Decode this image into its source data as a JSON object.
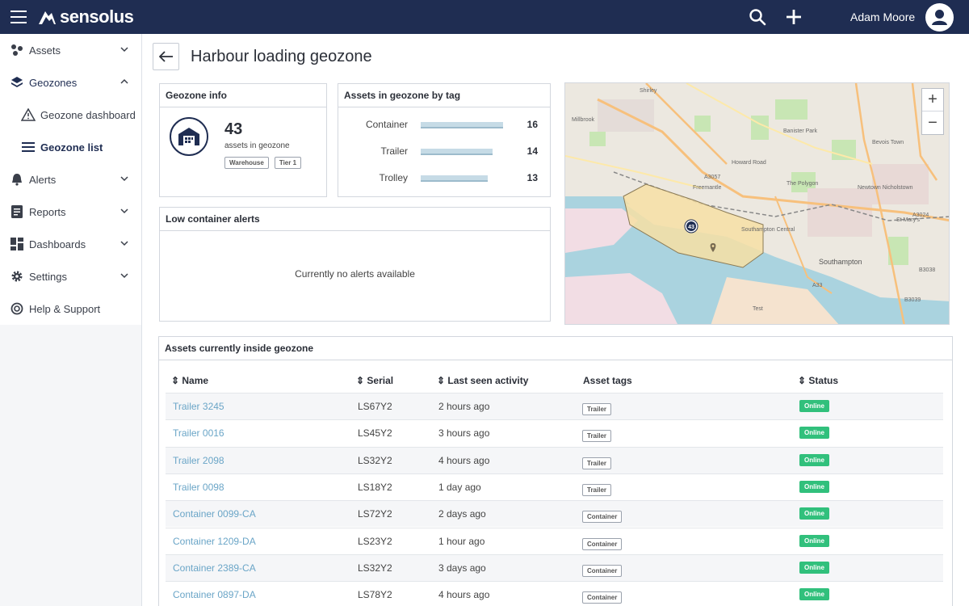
{
  "topbar": {
    "brand": "sensolus",
    "user_name": "Adam Moore"
  },
  "sidebar": {
    "items": [
      {
        "label": "Assets"
      },
      {
        "label": "Geozones"
      },
      {
        "label": "Geozone dashboard"
      },
      {
        "label": "Geozone list"
      },
      {
        "label": "Alerts"
      },
      {
        "label": "Reports"
      },
      {
        "label": "Dashboards"
      },
      {
        "label": "Settings"
      },
      {
        "label": "Help & Support"
      }
    ]
  },
  "page": {
    "title": "Harbour loading geozone"
  },
  "geozone_info": {
    "title": "Geozone info",
    "count": "43",
    "count_label": "assets in geozone",
    "tags": [
      "Warehouse",
      "Tier 1"
    ]
  },
  "assets_by_tag": {
    "title": "Assets in geozone by tag",
    "rows": [
      {
        "label": "Container",
        "value": 16
      },
      {
        "label": "Trailer",
        "value": 14
      },
      {
        "label": "Trolley",
        "value": 13
      }
    ]
  },
  "alerts": {
    "title": "Low container alerts",
    "empty_text": "Currently no alerts available"
  },
  "map": {
    "marker_count": "43",
    "labels": [
      "Shirley",
      "Millbrook",
      "Freemantle",
      "Southampton Central",
      "Bevois Town",
      "Banister Park",
      "The Polygon",
      "Newtown Nicholstown",
      "St Mary's",
      "Southampton",
      "Howard Road",
      "A3057",
      "A3024",
      "A33",
      "B3038",
      "B3039",
      "Test"
    ]
  },
  "table": {
    "title": "Assets currently inside geozone",
    "columns": [
      "Name",
      "Serial",
      "Last seen activity",
      "Asset tags",
      "Status"
    ],
    "rows": [
      {
        "name": "Trailer 3245",
        "serial": "LS67Y2",
        "last_seen": "2 hours ago",
        "tag": "Trailer",
        "status": "Online"
      },
      {
        "name": "Trailer 0016",
        "serial": "LS45Y2",
        "last_seen": "3 hours ago",
        "tag": "Trailer",
        "status": "Online"
      },
      {
        "name": "Trailer 2098",
        "serial": "LS32Y2",
        "last_seen": "4 hours ago",
        "tag": "Trailer",
        "status": "Online"
      },
      {
        "name": "Trailer 0098",
        "serial": "LS18Y2",
        "last_seen": "1 day ago",
        "tag": "Trailer",
        "status": "Online"
      },
      {
        "name": "Container 0099-CA",
        "serial": "LS72Y2",
        "last_seen": "2 days ago",
        "tag": "Container",
        "status": "Online"
      },
      {
        "name": "Container 1209-DA",
        "serial": "LS23Y2",
        "last_seen": "1 hour ago",
        "tag": "Container",
        "status": "Online"
      },
      {
        "name": "Container 2389-CA",
        "serial": "LS32Y2",
        "last_seen": "3 days ago",
        "tag": "Container",
        "status": "Online"
      },
      {
        "name": "Container 0897-DA",
        "serial": "LS78Y2",
        "last_seen": "4 hours ago",
        "tag": "Container",
        "status": "Online"
      }
    ]
  },
  "colors": {
    "brand_navy": "#1f2d52",
    "link": "#6aa5c7",
    "status_online": "#31c07c"
  }
}
